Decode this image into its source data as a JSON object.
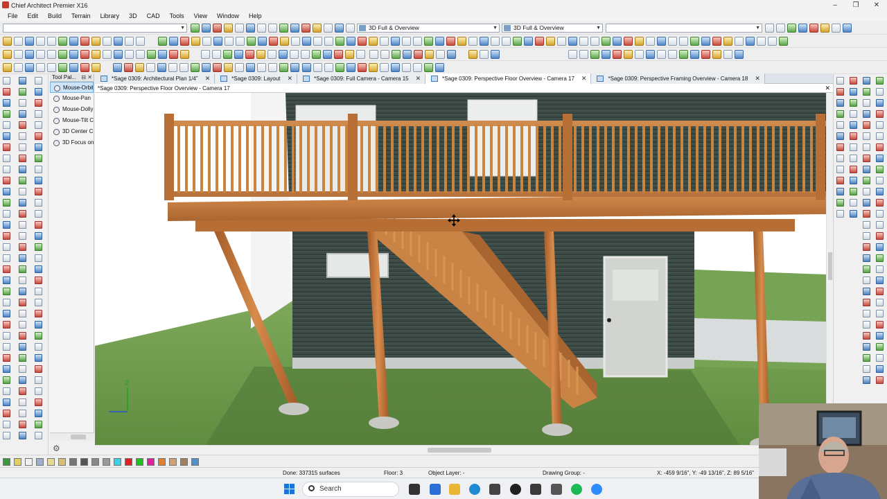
{
  "app": {
    "title": "Chief Architect Premier X16"
  },
  "window_controls": {
    "minimize": "–",
    "restore": "❐",
    "close": "✕"
  },
  "menu": [
    "File",
    "Edit",
    "Build",
    "Terrain",
    "Library",
    "3D",
    "CAD",
    "Tools",
    "View",
    "Window",
    "Help"
  ],
  "toolbar": {
    "layer_set_1": "3D Full & Overview",
    "layer_set_2": "3D Full & Overview"
  },
  "tool_palette": {
    "title": "Tool Pal...",
    "buttons": "⊟ ✕",
    "items": [
      "Mouse-Orbit",
      "Mouse-Pan",
      "Mouse-Dolly",
      "Mouse-Tilt C",
      "3D Center C",
      "3D Focus on"
    ]
  },
  "tabs": [
    {
      "label": "*Sage 0309: Architectural Plan 1/4\"",
      "close": "✕"
    },
    {
      "label": "*Sage 0309: Layout",
      "close": "✕"
    },
    {
      "label": "*Sage 0309: Full Camera - Camera 15",
      "close": "✕"
    },
    {
      "label": "*Sage 0309: Perspective Floor Overview - Camera 17",
      "close": "✕"
    },
    {
      "label": "*Sage 0309: Perspective Framing Overview - Camera 18",
      "close": "✕"
    }
  ],
  "view": {
    "title": "*Sage 0309: Perspective Floor Overview - Camera 17",
    "close": "✕",
    "axis_z": "Z"
  },
  "status": {
    "done": "Done: 337315 surfaces",
    "floor": "Floor: 3",
    "layer": "Object Layer: -",
    "group": "Drawing Group: -",
    "coords": "X: -459 9/16\", Y: -49 13/16\", Z: 89 5/16\""
  },
  "taskbar": {
    "search_placeholder": "Search"
  },
  "colors": {
    "sky": "#ffffff",
    "siding": "#3c4a46",
    "deck_wood": "#c27e45",
    "grass": "#6f9a4e",
    "accent": "#1a73d6"
  }
}
